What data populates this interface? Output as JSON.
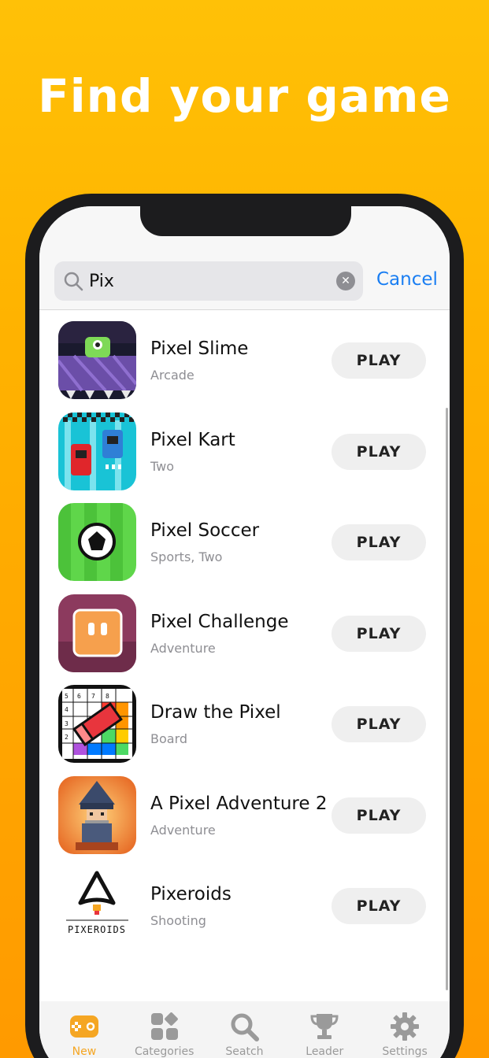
{
  "headline": "Find your game",
  "search": {
    "query": "Pix",
    "cancel_label": "Cancel"
  },
  "results": [
    {
      "name": "Pixel Slime",
      "category": "Arcade",
      "play_label": "PLAY",
      "icon": "pixel-slime-icon"
    },
    {
      "name": "Pixel Kart",
      "category": "Two",
      "play_label": "PLAY",
      "icon": "pixel-kart-icon"
    },
    {
      "name": "Pixel Soccer",
      "category": "Sports, Two",
      "play_label": "PLAY",
      "icon": "pixel-soccer-icon"
    },
    {
      "name": "Pixel Challenge",
      "category": "Adventure",
      "play_label": "PLAY",
      "icon": "pixel-challenge-icon"
    },
    {
      "name": "Draw the Pixel",
      "category": "Board",
      "play_label": "PLAY",
      "icon": "draw-the-pixel-icon"
    },
    {
      "name": "A Pixel Adventure 2",
      "category": "Adventure",
      "play_label": "PLAY",
      "icon": "pixel-adventure-icon"
    },
    {
      "name": "Pixeroids",
      "category": "Shooting",
      "play_label": "PLAY",
      "icon": "pixeroids-icon",
      "icon_text": "PIXEROIDS"
    }
  ],
  "tabs": [
    {
      "label": "New",
      "icon": "gamepad-icon",
      "active": true
    },
    {
      "label": "Categories",
      "icon": "categories-icon",
      "active": false
    },
    {
      "label": "Seatch",
      "icon": "search-icon",
      "active": false
    },
    {
      "label": "Leader",
      "icon": "trophy-icon",
      "active": false
    },
    {
      "label": "Settings",
      "icon": "gear-icon",
      "active": false
    }
  ],
  "colors": {
    "background_top": "#FFC107",
    "background_bottom": "#FF9A00",
    "accent": "#1a7ef2",
    "active_tab": "#f5a623"
  }
}
